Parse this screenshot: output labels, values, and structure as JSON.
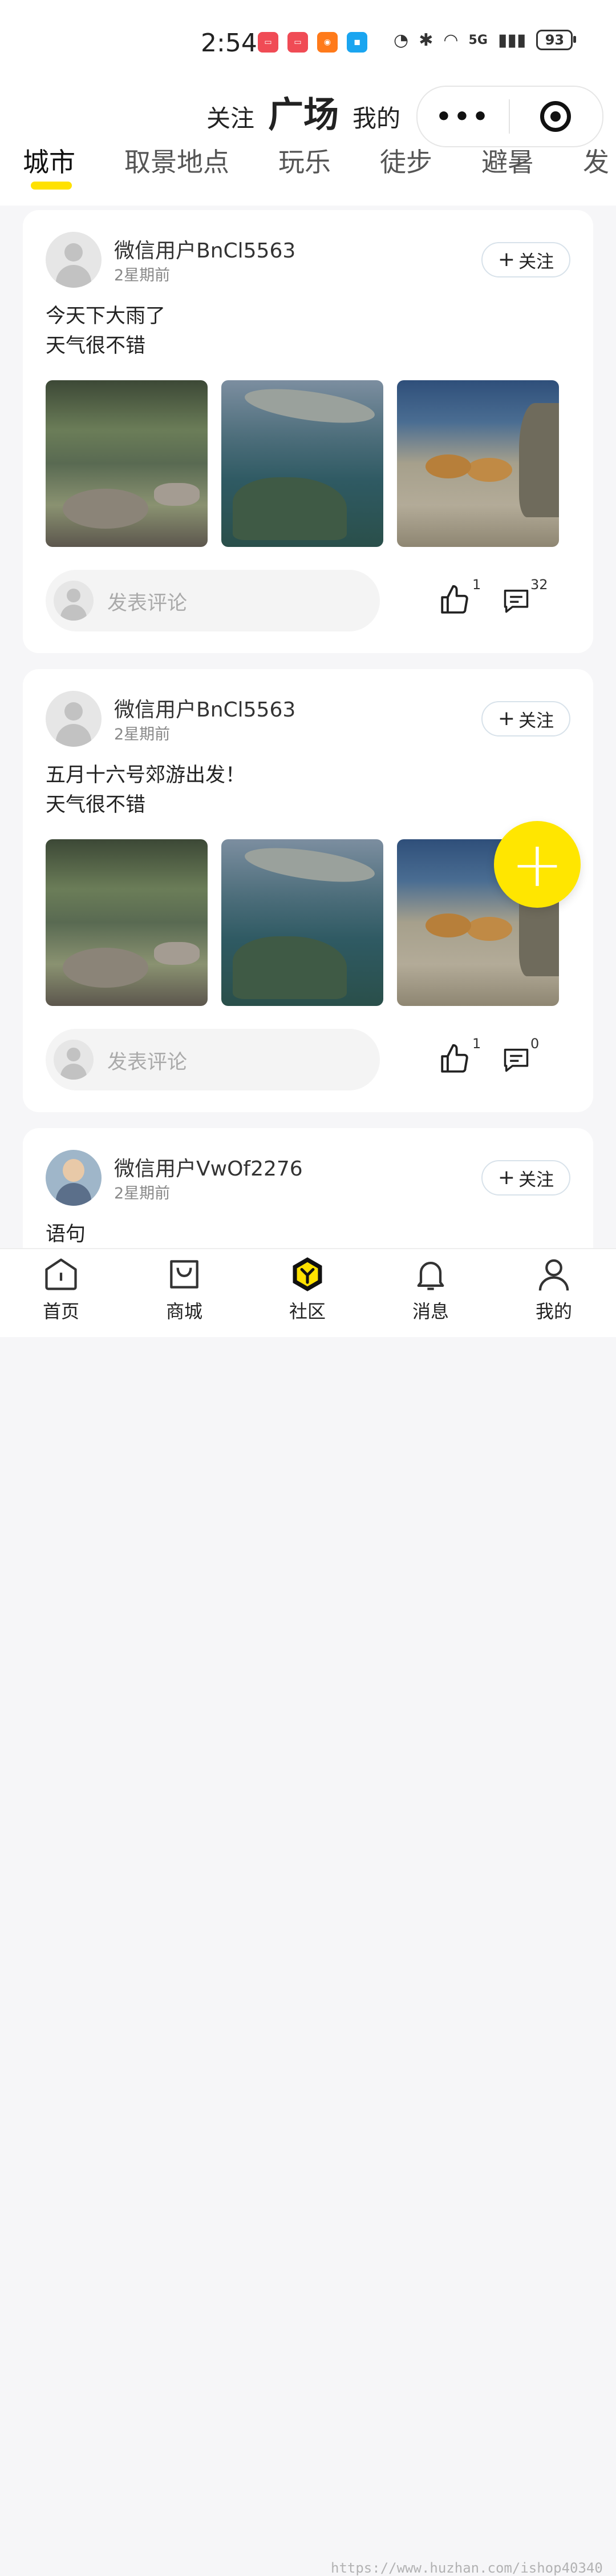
{
  "status_bar": {
    "time": "2:54",
    "network": "5G",
    "battery": "93",
    "app_icons": [
      {
        "name": "huawei-app-icon",
        "color": "#f04b55"
      },
      {
        "name": "huawei-app-icon",
        "color": "#f04b55"
      },
      {
        "name": "kuaishou-icon",
        "color": "#ff7a1a"
      },
      {
        "name": "message-app-icon",
        "color": "#1aa5f0"
      }
    ]
  },
  "header": {
    "tabs": [
      "关注",
      "广场",
      "我的"
    ],
    "active_tab": "广场"
  },
  "categories": {
    "items": [
      "城市",
      "取景地点",
      "玩乐",
      "徒步",
      "避暑",
      "发"
    ],
    "active": "城市",
    "accent_color": "#ffe100"
  },
  "posts": [
    {
      "user": "微信用户BnCl5563",
      "time": "2星期前",
      "follow": "关注",
      "lines": [
        "今天下大雨了",
        "天气很不错"
      ],
      "comment_placeholder": "发表评论",
      "likes": "1",
      "comments": "32"
    },
    {
      "user": "微信用户BnCl5563",
      "time": "2星期前",
      "follow": "关注",
      "lines": [
        "五月十六号郊游出发！",
        "天气很不错"
      ],
      "comment_placeholder": "发表评论",
      "likes": "1",
      "comments": "0"
    },
    {
      "user": "微信用户VwOf2276",
      "time": "2星期前",
      "follow": "关注",
      "lines": [
        "语句"
      ]
    }
  ],
  "bottom_nav": {
    "items": [
      {
        "label": "首页",
        "icon": "home-icon"
      },
      {
        "label": "商城",
        "icon": "shopping-bag-icon"
      },
      {
        "label": "社区",
        "icon": "community-icon"
      },
      {
        "label": "消息",
        "icon": "bell-icon"
      },
      {
        "label": "我的",
        "icon": "user-icon"
      }
    ],
    "active": "社区"
  },
  "watermark": "https://www.huzhan.com/ishop40340"
}
